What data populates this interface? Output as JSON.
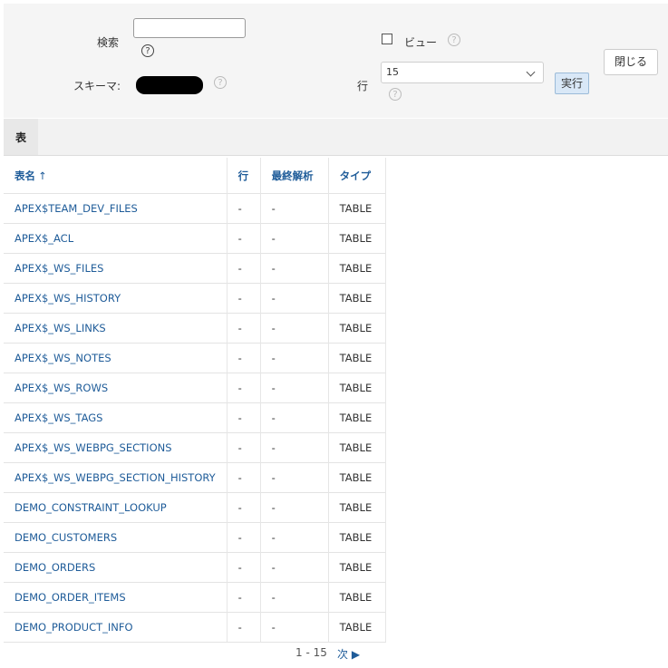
{
  "form": {
    "search_label": "検索",
    "search_value": "",
    "schema_label": "スキーマ:",
    "view_label": "ビュー",
    "rows_label": "行",
    "rows_value": "15",
    "help_glyph": "?",
    "run_button": "実行",
    "close_button": "閉じる"
  },
  "tab": {
    "label": "表"
  },
  "table": {
    "headers": {
      "name": "表名",
      "sort_icon": "↑",
      "rows": "行",
      "analyzed": "最終解析",
      "type": "タイプ"
    },
    "rows": [
      {
        "name": "APEX$TEAM_DEV_FILES",
        "rows": "-",
        "analyzed": "-",
        "type": "TABLE"
      },
      {
        "name": "APEX$_ACL",
        "rows": "-",
        "analyzed": "-",
        "type": "TABLE"
      },
      {
        "name": "APEX$_WS_FILES",
        "rows": "-",
        "analyzed": "-",
        "type": "TABLE"
      },
      {
        "name": "APEX$_WS_HISTORY",
        "rows": "-",
        "analyzed": "-",
        "type": "TABLE"
      },
      {
        "name": "APEX$_WS_LINKS",
        "rows": "-",
        "analyzed": "-",
        "type": "TABLE"
      },
      {
        "name": "APEX$_WS_NOTES",
        "rows": "-",
        "analyzed": "-",
        "type": "TABLE"
      },
      {
        "name": "APEX$_WS_ROWS",
        "rows": "-",
        "analyzed": "-",
        "type": "TABLE"
      },
      {
        "name": "APEX$_WS_TAGS",
        "rows": "-",
        "analyzed": "-",
        "type": "TABLE"
      },
      {
        "name": "APEX$_WS_WEBPG_SECTIONS",
        "rows": "-",
        "analyzed": "-",
        "type": "TABLE"
      },
      {
        "name": "APEX$_WS_WEBPG_SECTION_HISTORY",
        "rows": "-",
        "analyzed": "-",
        "type": "TABLE"
      },
      {
        "name": "DEMO_CONSTRAINT_LOOKUP",
        "rows": "-",
        "analyzed": "-",
        "type": "TABLE"
      },
      {
        "name": "DEMO_CUSTOMERS",
        "rows": "-",
        "analyzed": "-",
        "type": "TABLE"
      },
      {
        "name": "DEMO_ORDERS",
        "rows": "-",
        "analyzed": "-",
        "type": "TABLE"
      },
      {
        "name": "DEMO_ORDER_ITEMS",
        "rows": "-",
        "analyzed": "-",
        "type": "TABLE"
      },
      {
        "name": "DEMO_PRODUCT_INFO",
        "rows": "-",
        "analyzed": "-",
        "type": "TABLE"
      }
    ]
  },
  "pagination": {
    "range": "1 - 15",
    "next": "次"
  },
  "colors": {
    "link": "#1f5c99",
    "panel": "#f5f5f5",
    "run_button_bg": "#d9e8f7"
  }
}
